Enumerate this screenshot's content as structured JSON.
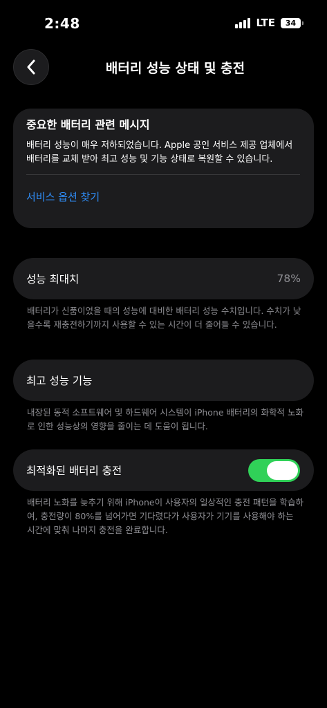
{
  "status_bar": {
    "time": "2:48",
    "network": "LTE",
    "battery_level": "34"
  },
  "nav": {
    "title": "배터리 성능 상태 및 충전"
  },
  "important_message": {
    "title": "중요한 배터리 관련 메시지",
    "body": "배터리 성능이 매우 저하되었습니다. Apple 공인 서비스 제공 업체에서 배터리를 교체 받아 최고 성능 및 기능 상태로 복원할 수 있습니다.",
    "link_label": "서비스 옵션 찾기",
    "link_color": "#2f8cf5"
  },
  "maximum_capacity": {
    "label": "성능 최대치",
    "value": "78%",
    "footnote": "배터리가 신품이었을 때의 성능에 대비한 배터리 성능 수치입니다. 수치가 낮을수록 재충전하기까지 사용할 수 있는 시간이 더 줄어들 수 있습니다."
  },
  "peak_performance": {
    "label": "최고 성능 기능",
    "footnote": "내장된 동적 소프트웨어 및 하드웨어 시스템이 iPhone 배터리의 화학적 노화로 인한 성능상의 영향을 줄이는 데 도움이 됩니다."
  },
  "optimized_charging": {
    "label": "최적화된 배터리 충전",
    "enabled": true,
    "toggle_color": "#30d158",
    "footnote": "배터리 노화를 늦추기 위해 iPhone이 사용자의 일상적인 충전 패턴을 학습하여, 충전량이 80%를 넘어가면 기다렸다가 사용자가 기기를 사용해야 하는 시간에 맞춰 나머지 충전을 완료합니다."
  },
  "icons": {
    "back": "chevron-left-icon",
    "signal": "cellular-signal-icon",
    "battery": "battery-icon"
  }
}
